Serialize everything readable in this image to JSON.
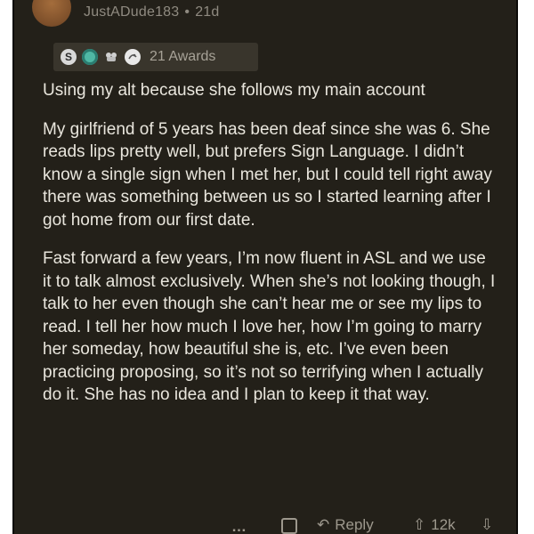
{
  "comment": {
    "username": "JustADude183",
    "separator": "•",
    "age": "21d",
    "awards": {
      "icons": [
        "silver-award-icon",
        "gem-award-icon",
        "wholesome-award-icon",
        "helpful-award-icon"
      ],
      "silver_glyph": "S",
      "count_label": "21 Awards"
    },
    "paragraphs": [
      "Using my alt because she follows my main account",
      "My girlfriend of 5 years has been deaf since she was 6. She reads lips pretty well, but prefers Sign Language. I didn’t know a single sign when I met her, but I could tell right away there was something between us so I started learning after I got home from our first date.",
      "Fast forward a few years, I’m now fluent in ASL and we use it to talk almost exclusively. When she’s not looking though, I talk to her even though she can’t hear me or see my lips to read. I tell her how much I love her, how I’m going to marry her someday, how beautiful she is, etc. I’ve even been practicing proposing, so it’s not so terrifying when I actually do it. She has no idea and I plan to keep it that way."
    ],
    "footer": {
      "more_glyph": "…",
      "reply_glyph": "↶",
      "reply_label": "Reply",
      "upvote_glyph": "⇧",
      "score": "12k",
      "downvote_glyph": "⇩"
    }
  },
  "colors": {
    "background": "#232019",
    "text": "#e9e6dd",
    "meta": "#8f8a80",
    "awards_bg": "#39352c"
  }
}
